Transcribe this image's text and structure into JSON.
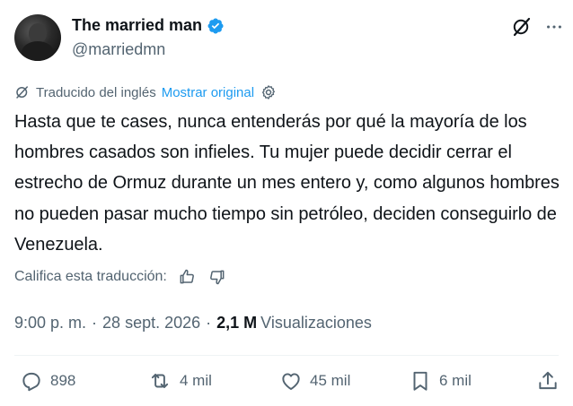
{
  "author": {
    "display_name": "The married man",
    "handle": "@marriedmn",
    "verified": true,
    "verified_color": "#1d9bf0"
  },
  "header_icons": [
    "grok-icon",
    "more-icon"
  ],
  "translation": {
    "label": "Traducido del inglés",
    "show_original": "Mostrar original",
    "link_color": "#1d9bf0"
  },
  "tweet": {
    "text": "Hasta que te cases, nunca entenderás por qué la mayoría de los hombres casados son infieles. Tu mujer puede decidir cerrar el estrecho de Ormuz durante un mes entero y, como algunos hombres no pueden pasar mucho tiempo sin petróleo, deciden conseguirlo de Venezuela."
  },
  "rate": {
    "label": "Califica esta traducción:"
  },
  "meta": {
    "time": "9:00 p. m.",
    "date": "28 sept. 2026",
    "views_count": "2,1 M",
    "views_label": "Visualizaciones",
    "separator": "·"
  },
  "actions": {
    "replies": "898",
    "reposts": "4 mil",
    "likes": "45 mil",
    "bookmarks": "6 mil"
  }
}
